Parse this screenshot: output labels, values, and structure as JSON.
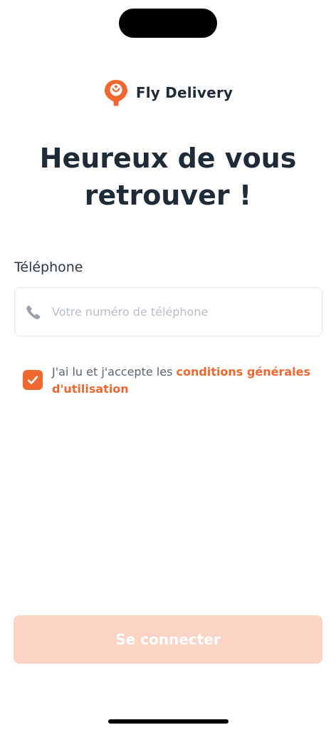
{
  "brand": {
    "name": "Fly Delivery"
  },
  "welcome": {
    "title": "Heureux de vous retrouver !"
  },
  "phone": {
    "label": "Téléphone",
    "placeholder": "Votre numéro de téléphone",
    "value": "",
    "icon": "phone-icon"
  },
  "terms": {
    "checked": true,
    "text": "J'ai lu et j'accepte les ",
    "link_label": "conditions générales d'utilisation"
  },
  "login": {
    "label": "Se connecter"
  },
  "colors": {
    "accent": "#f0682f",
    "button_disabled": "#fbd4c6",
    "title": "#1f2b38"
  }
}
